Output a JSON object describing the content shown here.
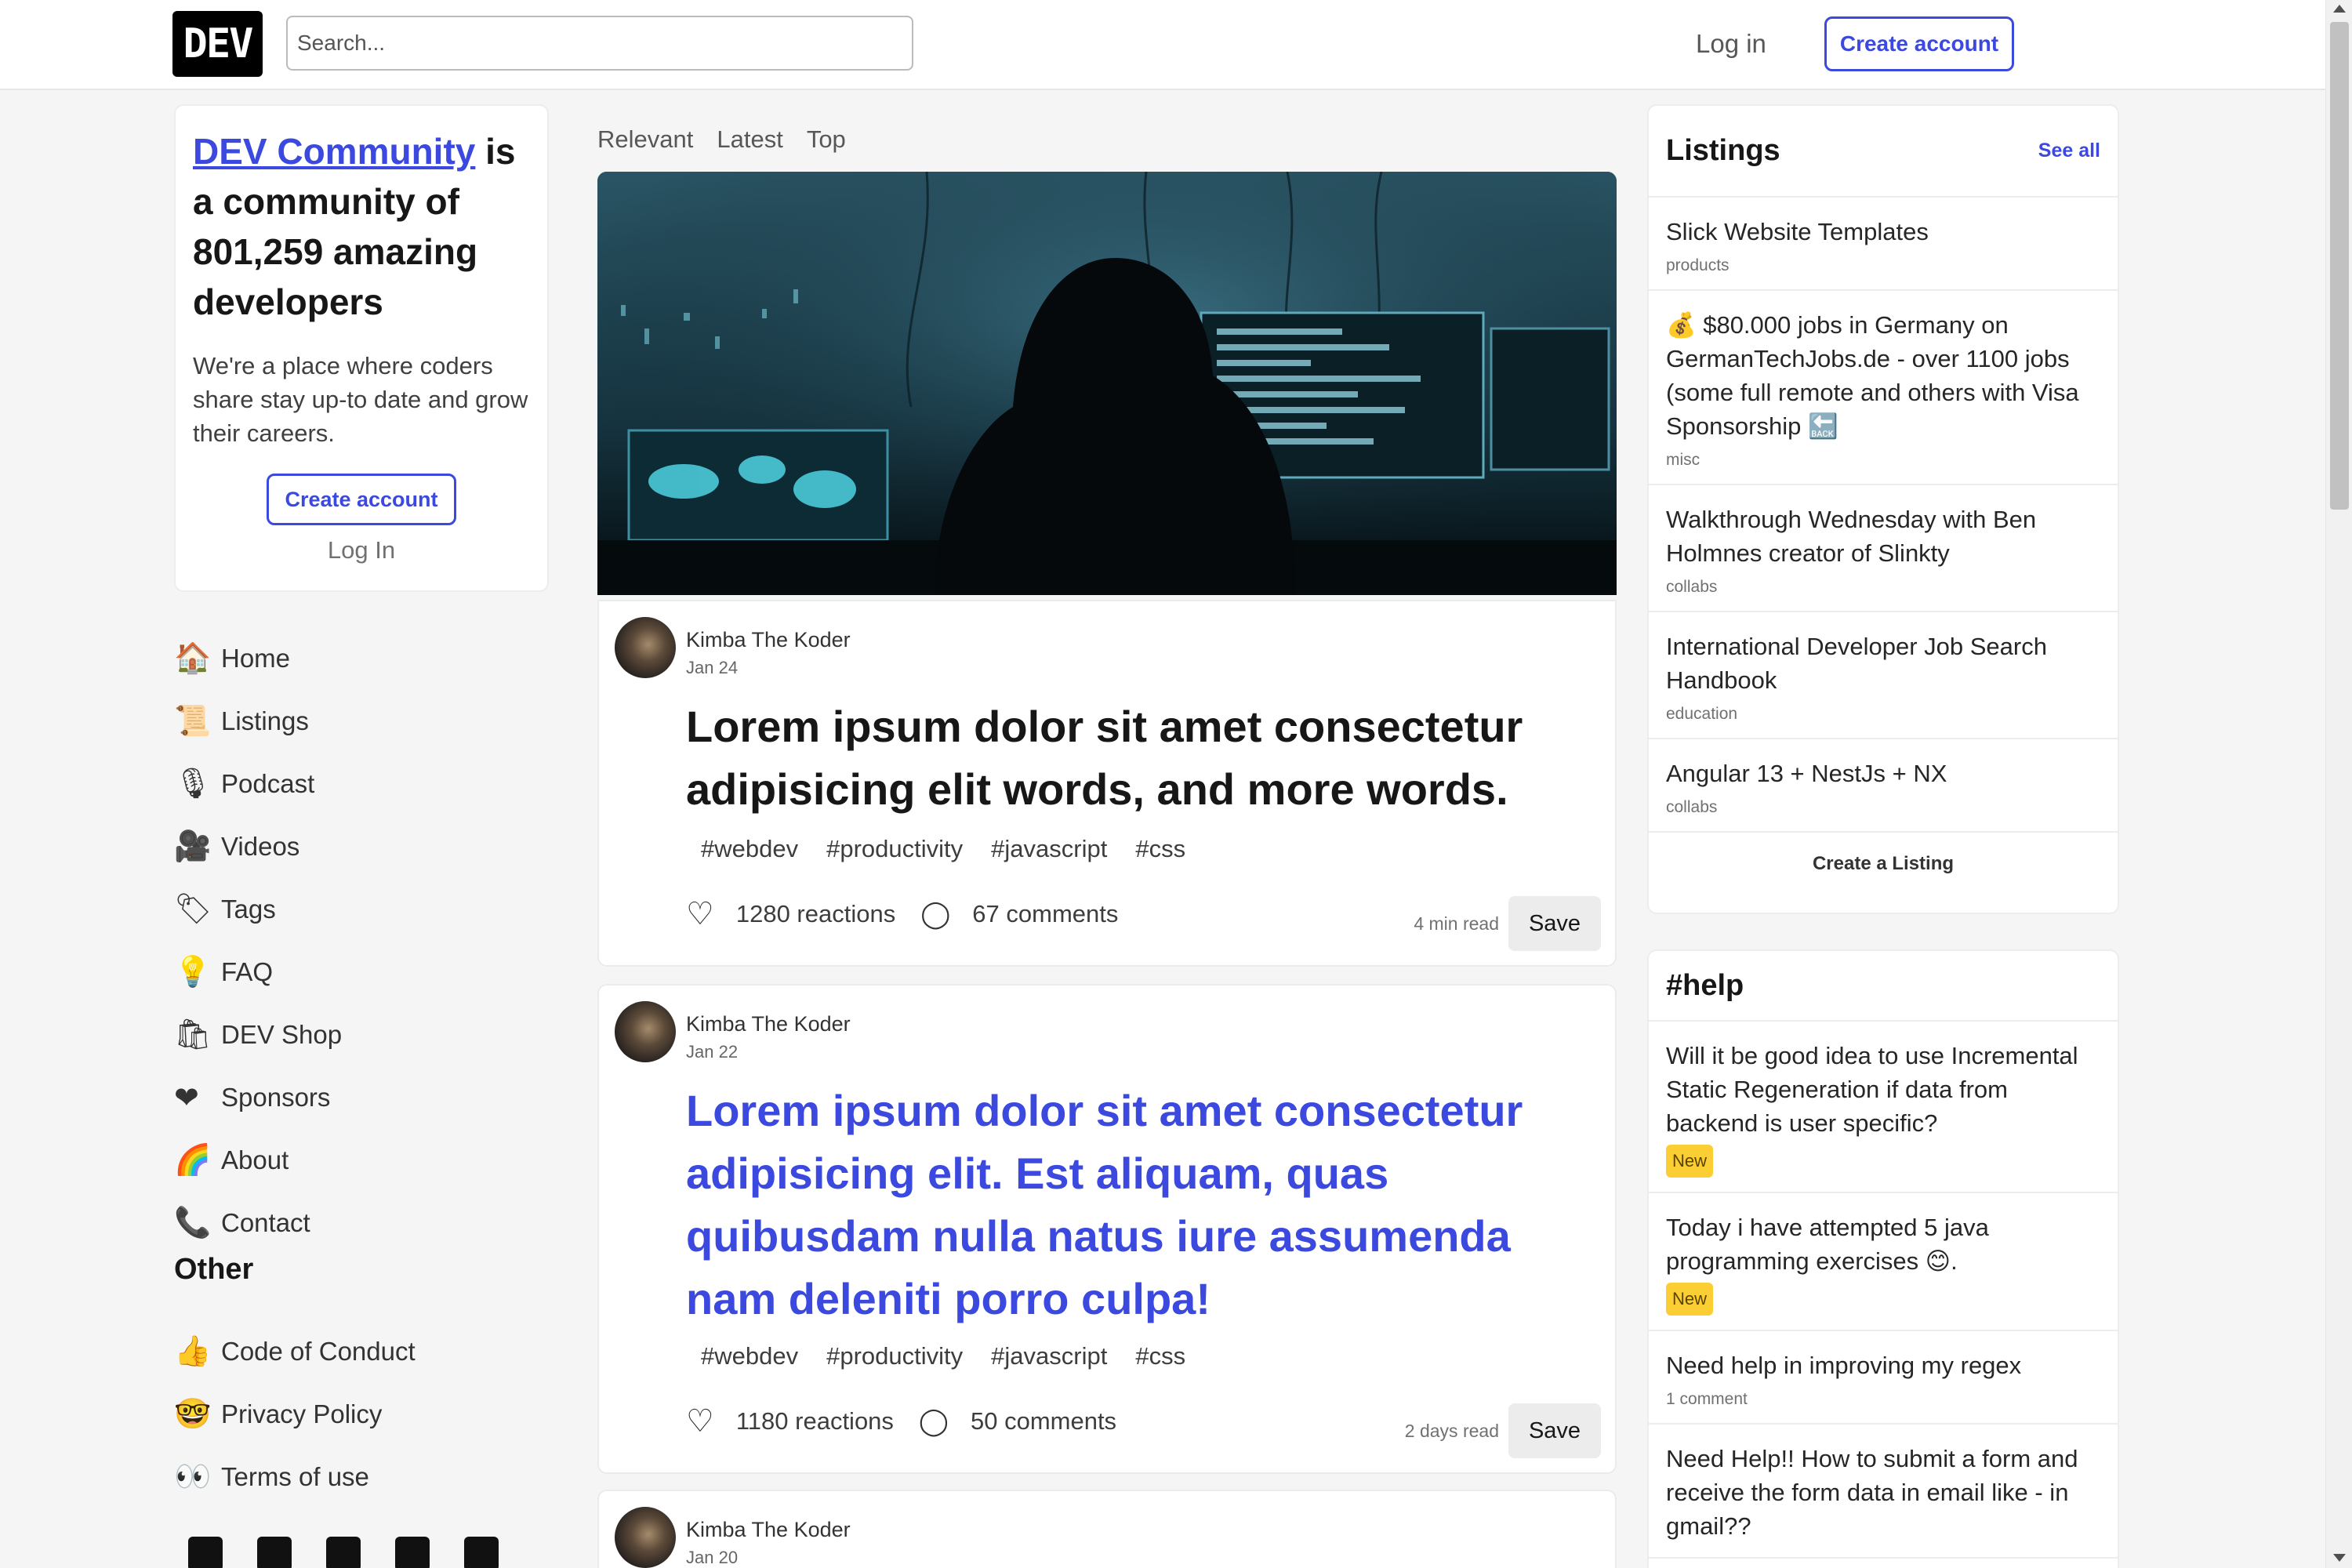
{
  "header": {
    "logo_text": "DEV",
    "search_placeholder": "Search...",
    "login_label": "Log in",
    "create_account_label": "Create account"
  },
  "community": {
    "link_text": "DEV Community",
    "title_rest": " is a community of 801,259 amazing developers",
    "description": "We're a place where coders share stay up-to date and grow their careers.",
    "create_account_label": "Create account",
    "login_label": "Log In"
  },
  "nav": {
    "items": [
      {
        "label": "Home",
        "icon": "house-icon",
        "glyph": "🏠"
      },
      {
        "label": "Listings",
        "icon": "scroll-icon",
        "glyph": "📜"
      },
      {
        "label": "Podcast",
        "icon": "microphone-icon",
        "glyph": "🎙"
      },
      {
        "label": "Videos",
        "icon": "camera-icon",
        "glyph": "🎥"
      },
      {
        "label": "Tags",
        "icon": "tag-icon",
        "glyph": "🏷"
      },
      {
        "label": "FAQ",
        "icon": "lightbulb-icon",
        "glyph": "💡"
      },
      {
        "label": "DEV Shop",
        "icon": "shopping-bags-icon",
        "glyph": "🛍"
      },
      {
        "label": "Sponsors",
        "icon": "heart-icon",
        "glyph": "❤"
      },
      {
        "label": "About",
        "icon": "dev-rainbow-logo-icon",
        "glyph": "🌈"
      },
      {
        "label": "Contact",
        "icon": "telephone-icon",
        "glyph": "📞"
      }
    ],
    "other_heading": "Other",
    "other_items": [
      {
        "label": "Code of Conduct",
        "icon": "thumbs-up-icon",
        "glyph": "👍"
      },
      {
        "label": "Privacy Policy",
        "icon": "nerd-face-icon",
        "glyph": "🤓"
      },
      {
        "label": "Terms of use",
        "icon": "eyes-icon",
        "glyph": "👀"
      }
    ],
    "social_icons": [
      "twitter-icon",
      "facebook-icon",
      "github-icon",
      "instagram-icon",
      "twitch-icon"
    ]
  },
  "feed": {
    "tabs": [
      "Relevant",
      "Latest",
      "Top"
    ],
    "posts": [
      {
        "author": "Kimba The Koder",
        "date": "Jan 24",
        "title": "Lorem ipsum dolor sit amet consectetur adipisicing elit words, and more words.",
        "tags": [
          "webdev",
          "productivity",
          "javascript",
          "css"
        ],
        "reactions": "1280 reactions",
        "comments": "67 comments",
        "read_time": "4 min read",
        "save_label": "Save"
      },
      {
        "author": "Kimba The Koder",
        "date": "Jan 22",
        "title": "Lorem ipsum dolor sit amet consectetur adipisicing elit. Est aliquam, quas quibusdam nulla natus iure assumenda nam deleniti porro culpa!",
        "tags": [
          "webdev",
          "productivity",
          "javascript",
          "css"
        ],
        "reactions": "1180 reactions",
        "comments": "50 comments",
        "read_time": "2 days read",
        "save_label": "Save"
      },
      {
        "author": "Kimba The Koder",
        "date": "Jan 20"
      }
    ]
  },
  "listings": {
    "heading": "Listings",
    "see_all": "See all",
    "items": [
      {
        "title": "Slick Website Templates",
        "category": "products"
      },
      {
        "title": "💰 $80.000 jobs in Germany on GermanTechJobs.de - over 1100 jobs (some full remote and others with Visa Sponsorship 🔙",
        "category": "misc"
      },
      {
        "title": "Walkthrough Wednesday with Ben Holmnes creator of Slinkty",
        "category": "collabs"
      },
      {
        "title": "International Developer Job Search Handbook",
        "category": "education"
      },
      {
        "title": "Angular 13 + NestJs + NX",
        "category": "collabs"
      }
    ],
    "create_label": "Create a Listing"
  },
  "help": {
    "heading": "#help",
    "items": [
      {
        "title": "Will it be good idea to use Incremental Static Regeneration if data from backend is user specific?",
        "badge": "New"
      },
      {
        "title": "Today i have attempted 5 java programming exercises 😊.",
        "badge": "New"
      },
      {
        "title": "Need help in improving my regex",
        "sub": "1 comment"
      },
      {
        "title": "Need Help!! How to submit a form and receive the form data in email like - in gmail??"
      }
    ]
  },
  "colors": {
    "accent": "#3b49df",
    "badge": "#fbcf33",
    "background": "#f5f5f5"
  }
}
